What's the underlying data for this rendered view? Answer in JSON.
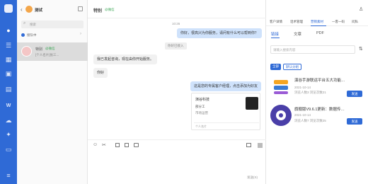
{
  "sidebar": {
    "icons": [
      "chat-icon",
      "contacts-icon",
      "calendar-icon",
      "grid-icon",
      "document-icon",
      "word-icon",
      "cloud-icon",
      "settings-icon",
      "bag-icon",
      "menu-icon"
    ]
  },
  "conv": {
    "title": "测试",
    "search_placeholder": "搜索",
    "filter_label": "接队中",
    "item": {
      "name": "特别",
      "tag": "@微信",
      "preview": "[个人名片]张三..."
    }
  },
  "chat": {
    "title": "特别",
    "title_tag": "@微信",
    "timestamp": "10:26",
    "messages": {
      "m1": "你好，很高兴为你服务，请问有什么可以帮到你？",
      "sys1": "你好已接入",
      "m2": "我已发起咨询，现在由你开始服务。",
      "m3": "你好",
      "m4": "这是您的专属客户经理，点击添加为好友"
    },
    "card": {
      "title": "演谷科技",
      "name": "部分工",
      "role": "市场运营",
      "footer": "个人名片"
    },
    "send_hint": "发送(S)"
  },
  "right": {
    "tabs": [
      "客户详情",
      "话术管理",
      "营销素材",
      "一客一码",
      "问私"
    ],
    "subtabs": [
      "链接",
      "文章",
      "PDF"
    ],
    "search_placeholder": "请输入搜索内容",
    "tags": [
      "全部",
      "默认分组"
    ],
    "items": [
      {
        "title": "演谷手游联运平台五大功能…",
        "date": "2021-10-14",
        "stats": "浏览人数3  浏览次数21",
        "send": "发送"
      },
      {
        "title": "旗舰版V9.6.1更新：数据传…",
        "date": "2021-10-14",
        "stats": "浏览人数7  浏览次数25",
        "send": "发送"
      }
    ]
  },
  "colors": {
    "rail": "#2f6ad6",
    "accent": "#2f6ad6",
    "bubble_right": "#cfe2fb"
  }
}
